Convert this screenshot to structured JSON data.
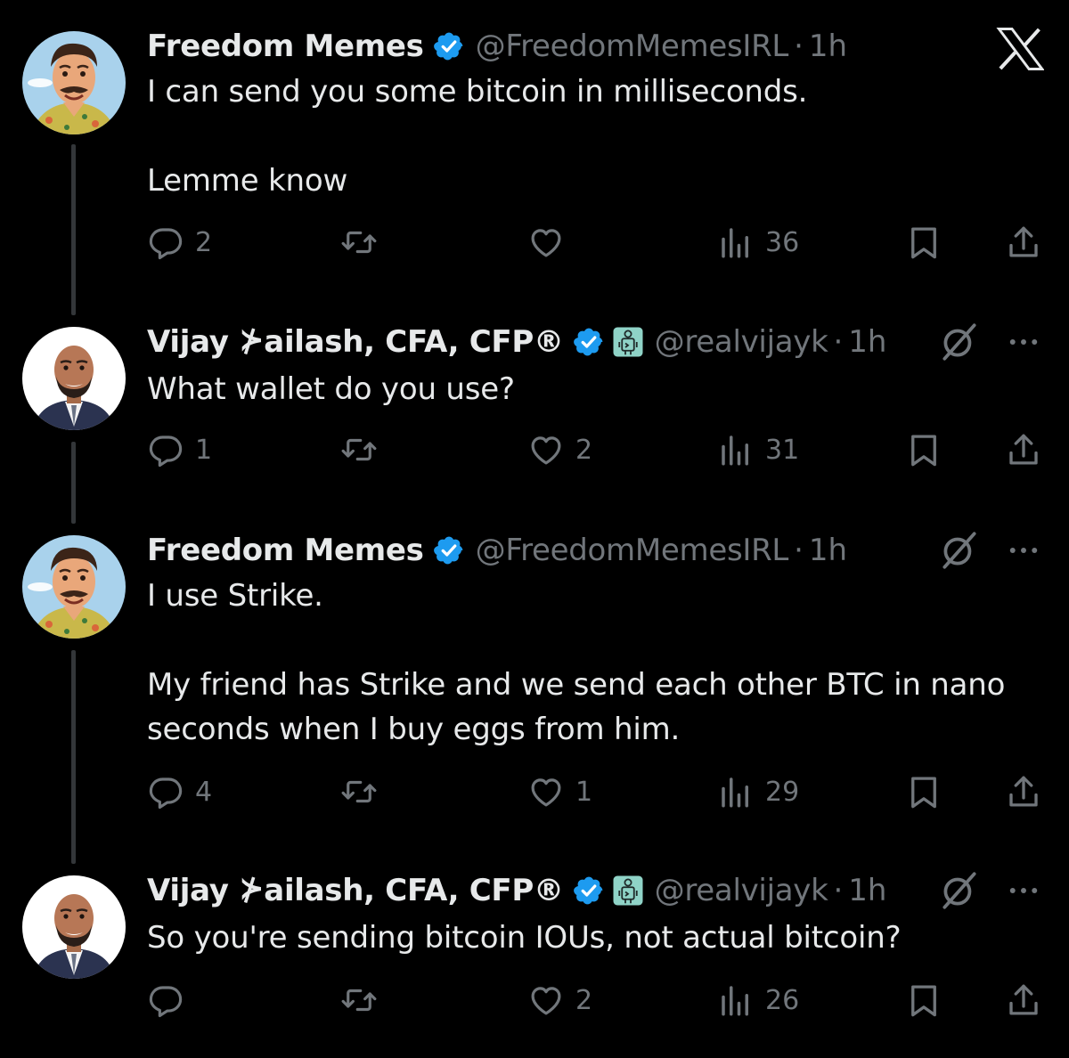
{
  "app": {
    "logo": "x-logo-icon"
  },
  "tweets": [
    {
      "name": "Freedom Memes",
      "handle": "@FreedomMemesIRL",
      "dot": "·",
      "time": "1h",
      "text": "I can send you some bitcoin in milliseconds.\n\nLemme know",
      "replies": "2",
      "reposts": "",
      "likes": "",
      "views": "36"
    },
    {
      "name": "Vijay ⊁ailash, CFA, CFP®",
      "handle": "@realvijayk",
      "dot": "·",
      "time": "1h",
      "text": "What wallet do you use?",
      "replies": "1",
      "reposts": "",
      "likes": "2",
      "views": "31"
    },
    {
      "name": "Freedom Memes",
      "handle": "@FreedomMemesIRL",
      "dot": "·",
      "time": "1h",
      "text": "I use Strike.\n\nMy friend has Strike and we send each other BTC in nano seconds when I buy eggs from him.",
      "replies": "4",
      "reposts": "",
      "likes": "1",
      "views": "29"
    },
    {
      "name": "Vijay ⊁ailash, CFA, CFP®",
      "handle": "@realvijayk",
      "dot": "·",
      "time": "1h",
      "text": "So you're sending bitcoin IOUs, not actual bitcoin?",
      "replies": "",
      "reposts": "",
      "likes": "2",
      "views": "26"
    }
  ],
  "colors": {
    "background": "#000000",
    "text": "#e7e9ea",
    "secondary": "#71767b",
    "verified": "#1d9bf0",
    "bot_badge": "#8fd3c7"
  }
}
